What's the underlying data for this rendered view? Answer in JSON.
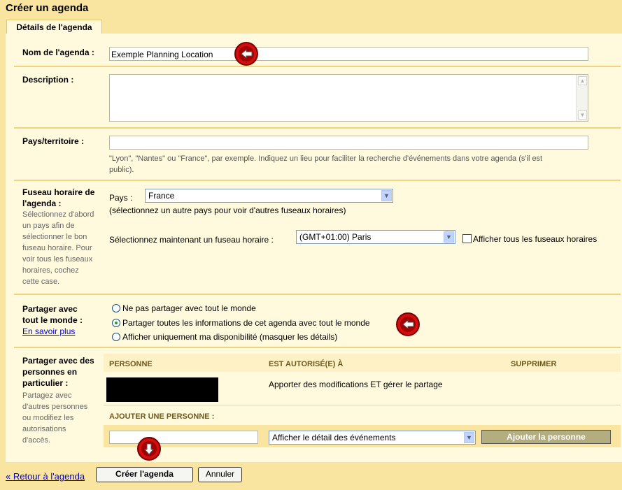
{
  "page_title": "Créer un agenda",
  "tab_label": "Détails de l'agenda",
  "name_row": {
    "label": "Nom de l'agenda :",
    "value": "Exemple Planning Location"
  },
  "description_row": {
    "label": "Description :",
    "value": ""
  },
  "country_row": {
    "label": "Pays/territoire :",
    "value": "",
    "hint_line1": "\"Lyon\", \"Nantes\" ou \"France\", par exemple. Indiquez un lieu pour faciliter la recherche d'événements dans votre agenda (s'il est",
    "hint_line2": "public)."
  },
  "timezone_row": {
    "label_line1": "Fuseau horaire de",
    "label_line2": "l'agenda :",
    "help": [
      "Sélectionnez d'abord",
      "un pays afin de",
      "sélectionner le bon",
      "fuseau horaire. Pour",
      "voir tous les fuseaux",
      "horaires, cochez",
      "cette case."
    ],
    "country_label": "Pays :",
    "country_value": "France",
    "country_hint": "(sélectionnez un autre pays pour voir d'autres fuseaux horaires)",
    "tz_label": "Sélectionnez maintenant un fuseau horaire :",
    "tz_value": "(GMT+01:00) Paris",
    "show_all_label": "Afficher tous les fuseaux horaires",
    "show_all_checked": false
  },
  "share_public_row": {
    "label_line1": "Partager avec",
    "label_line2": "tout le monde :",
    "learn_more": "En savoir plus",
    "options": [
      "Ne pas partager avec tout le monde",
      "Partager toutes les informations de cet agenda avec tout le monde",
      "Afficher uniquement ma disponibilité (masquer les détails)"
    ],
    "selected_index": 1
  },
  "share_people_row": {
    "label_line1": "Partager avec des",
    "label_line2": "personnes en",
    "label_line3": "particulier :",
    "help": [
      "Partagez avec",
      "d'autres personnes",
      "ou modifiez les",
      "autorisations",
      "d'accès."
    ],
    "col_person": "PERSONNE",
    "col_permission": "EST AUTORISÉ(E) À",
    "col_delete": "SUPPRIMER",
    "rows": [
      {
        "permission": "Apporter des modifications ET gérer le partage"
      }
    ],
    "add_header": "AJOUTER UNE PERSONNE :",
    "add_input_value": "",
    "add_permission_value": "Afficher le détail des événements",
    "add_button": "Ajouter la personne"
  },
  "footer": {
    "back_link": "« Retour à l'agenda",
    "create_button": "Créer l'agenda",
    "cancel_button": "Annuler"
  },
  "colors": {
    "frame": "#f9e5a0",
    "panel": "#fff9dd",
    "divider": "#f2d37e",
    "link": "#0000cc",
    "annotation_arrow": "#d10f0f"
  }
}
